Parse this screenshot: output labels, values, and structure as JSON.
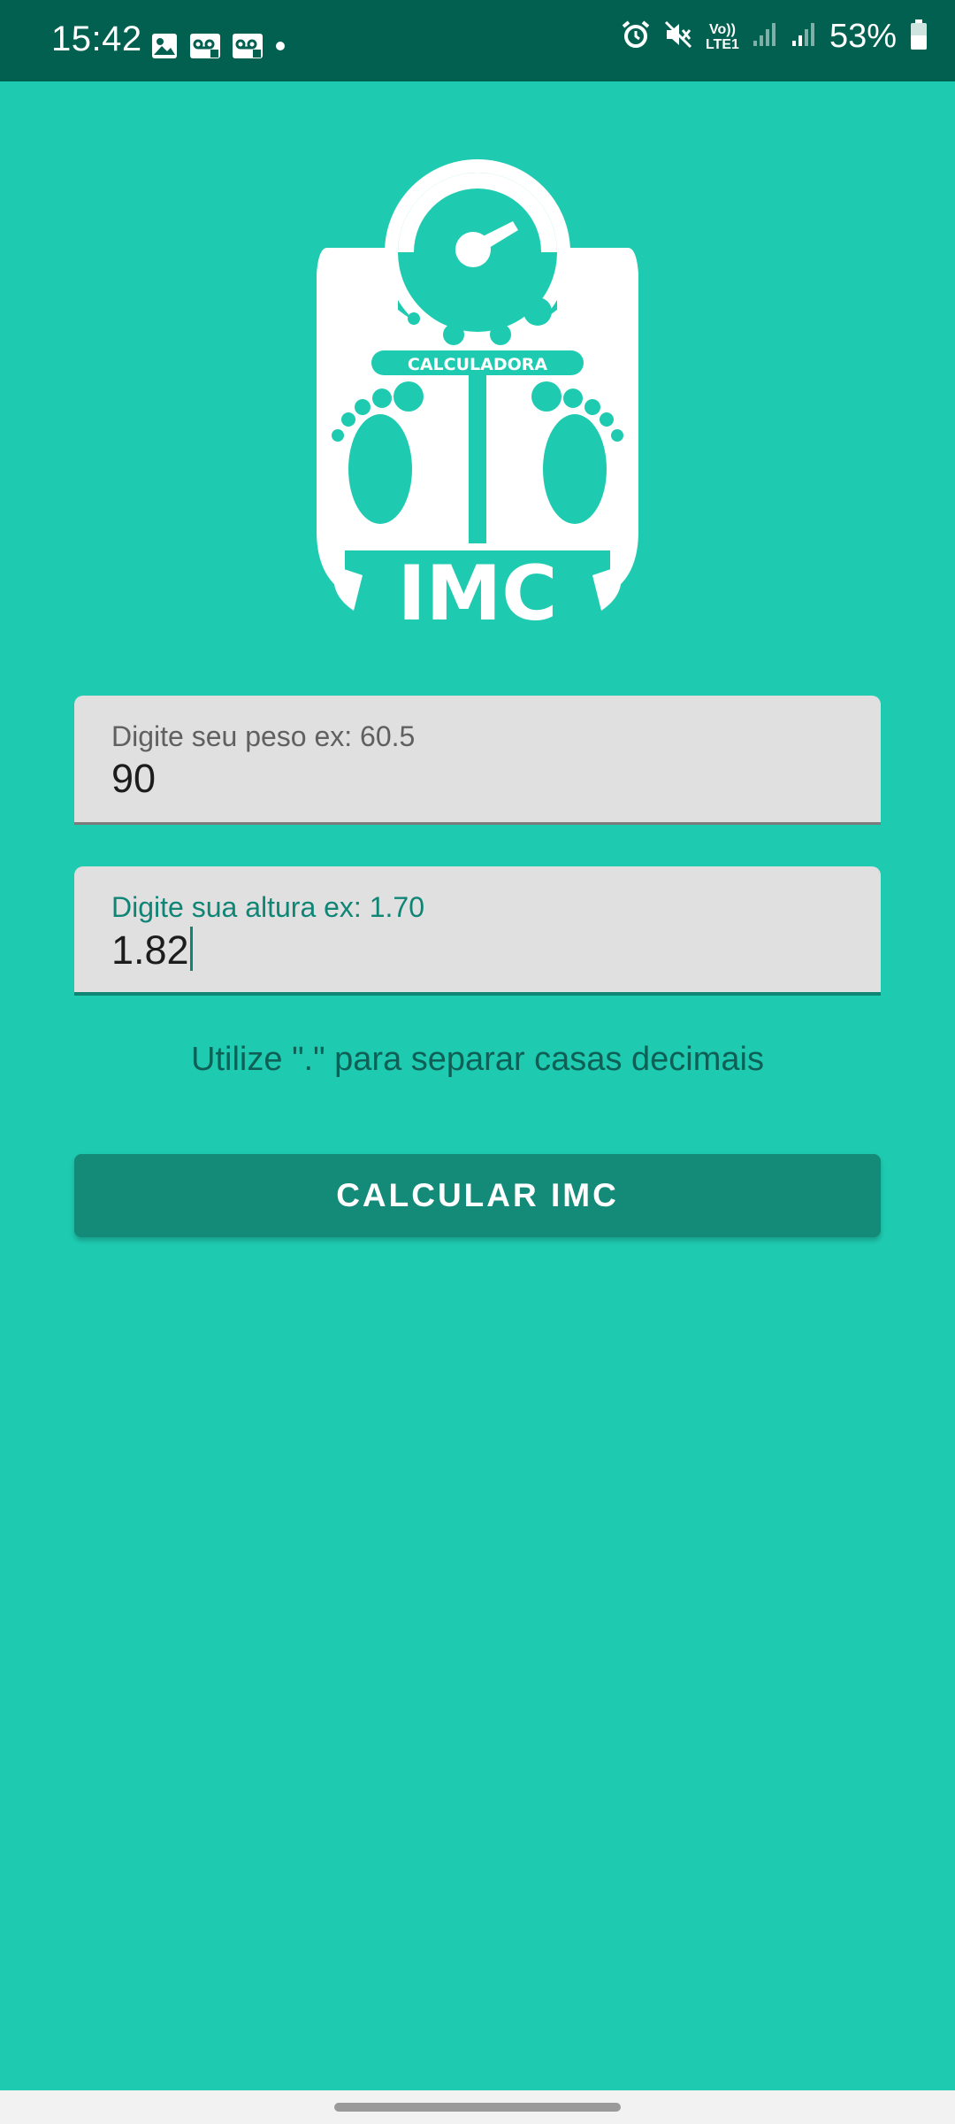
{
  "status_bar": {
    "time": "15:42",
    "left_icons": [
      "image-icon",
      "voicemail-icon",
      "voicemail-icon",
      "dot-icon"
    ],
    "right_icons": [
      "alarm-icon",
      "mute-icon",
      "volte-icon",
      "signal-icon",
      "signal-icon",
      "battery-icon"
    ],
    "volte_label_top": "Vo))",
    "volte_label_bottom": "LTE1",
    "battery": "53%"
  },
  "logo": {
    "top_text": "CALCULADORA",
    "main_text": "IMC"
  },
  "form": {
    "weight": {
      "label": "Digite seu peso ex: 60.5",
      "value": "90"
    },
    "height": {
      "label": "Digite sua altura ex: 1.70",
      "value": "1.82"
    },
    "hint": "Utilize \".\" para separar casas decimais",
    "submit_label": "CALCULAR IMC"
  },
  "colors": {
    "background": "#1ecbb1",
    "status_bar": "#01604f",
    "button": "#148a78",
    "accent": "#0f8576"
  }
}
